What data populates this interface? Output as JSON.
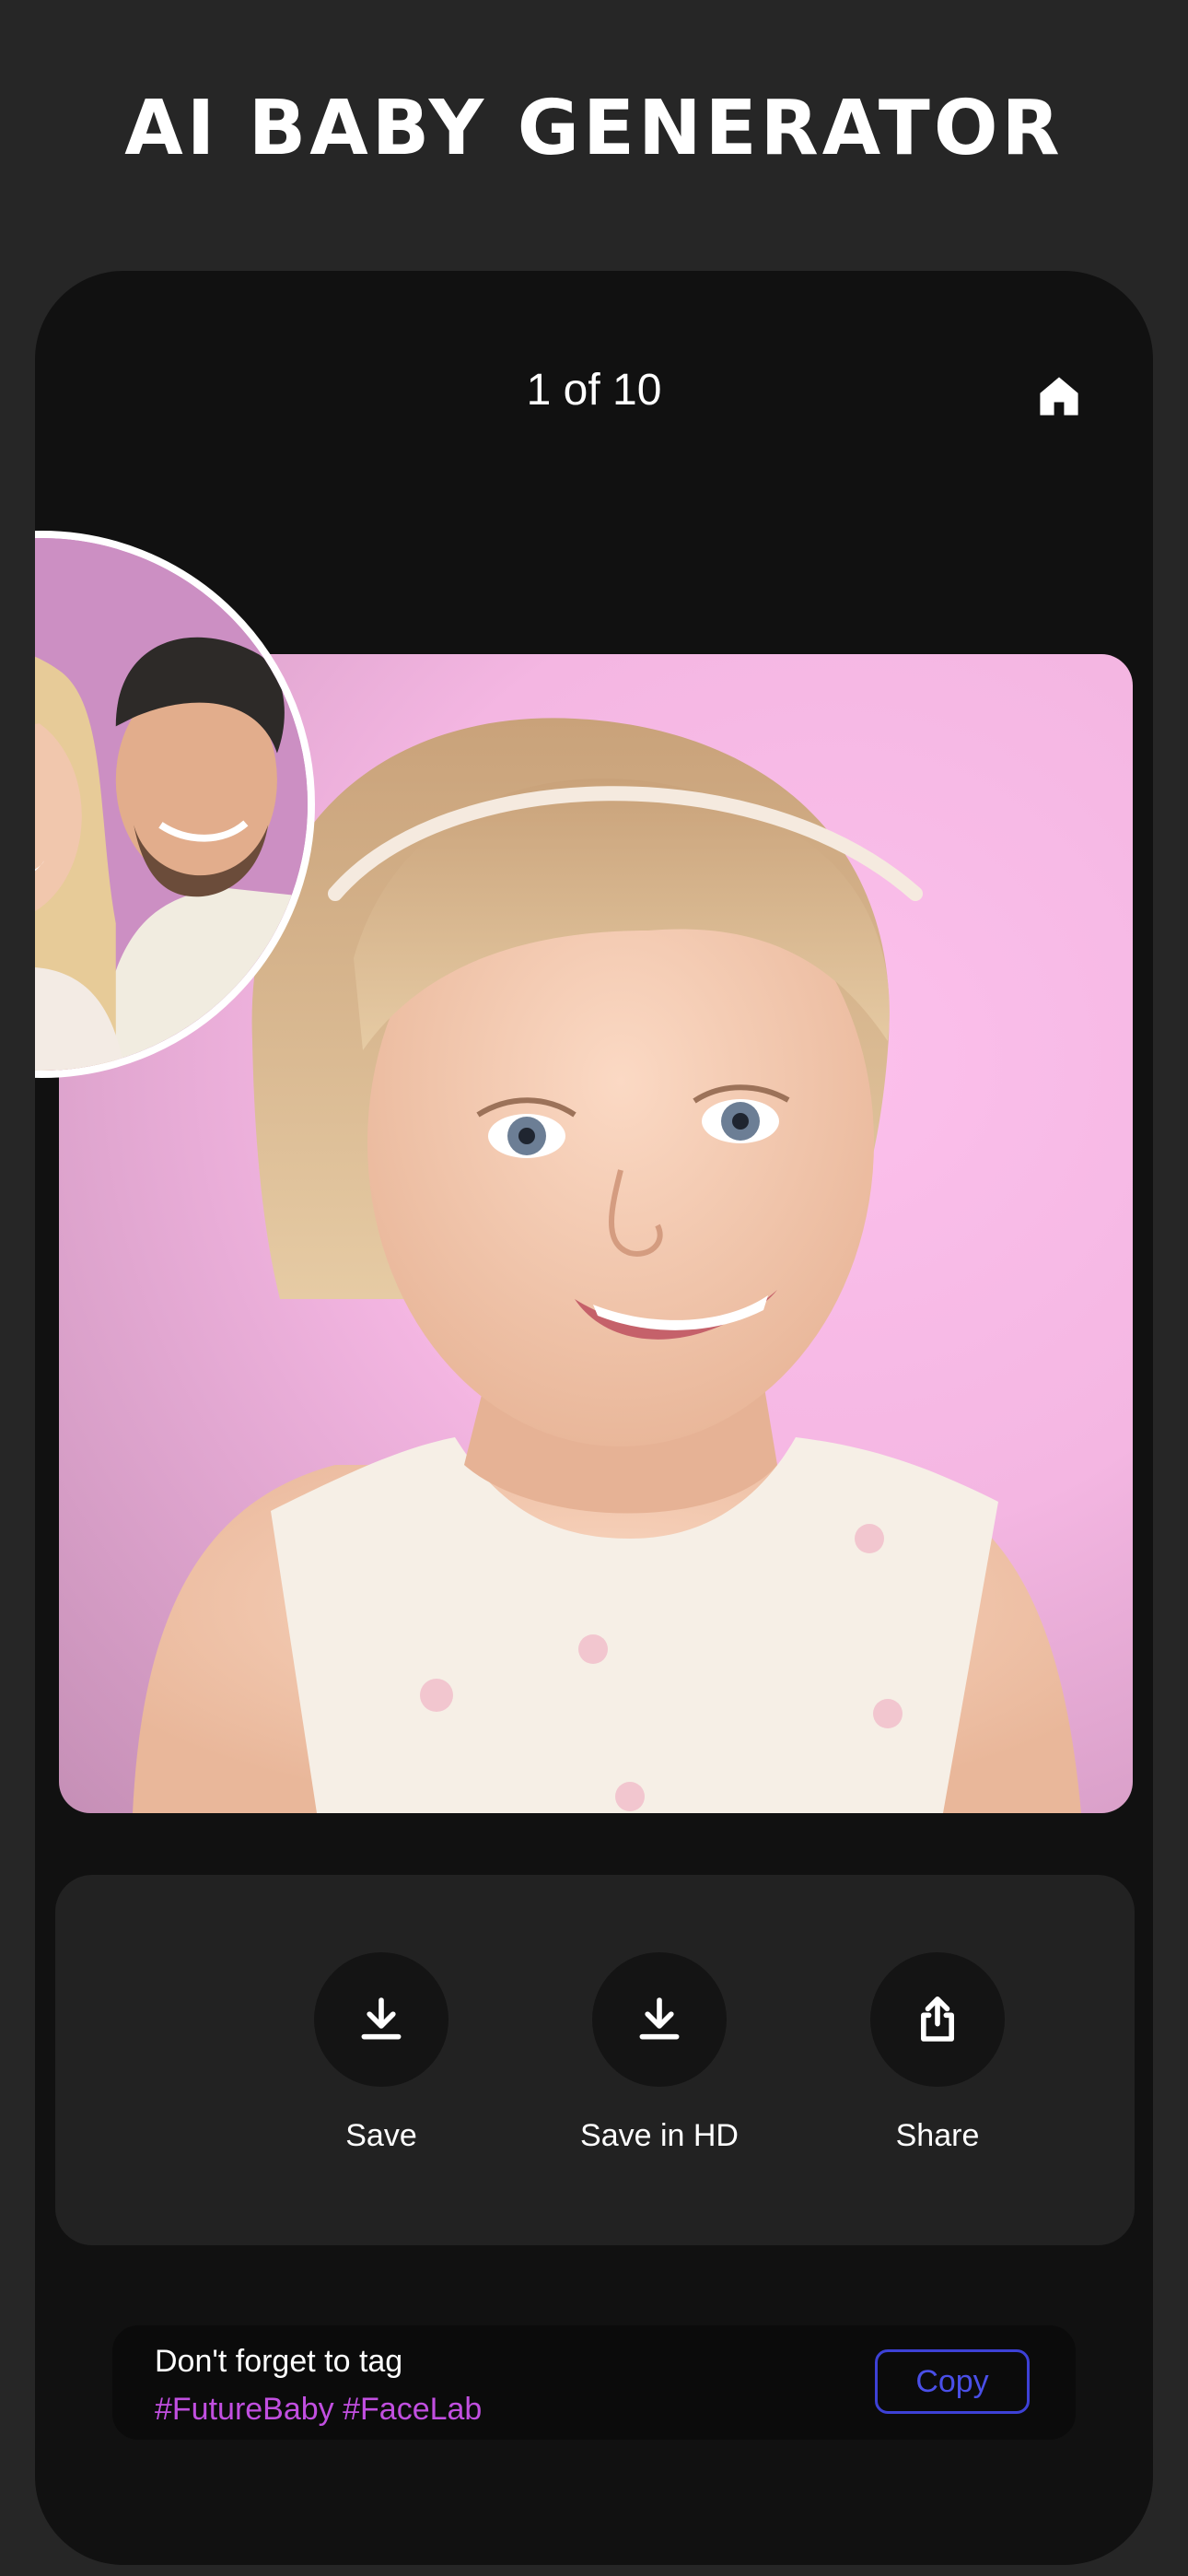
{
  "header": {
    "title": "AI BABY GENERATOR"
  },
  "viewer": {
    "counter": "1 of 10",
    "home_icon": "home-icon"
  },
  "actions": [
    {
      "label": "Save",
      "icon": "download-icon"
    },
    {
      "label": "Save in HD",
      "icon": "download-icon"
    },
    {
      "label": "Share",
      "icon": "share-icon"
    }
  ],
  "tag_bar": {
    "text": "Don't forget to tag",
    "hashtags": "#FutureBaby #FaceLab",
    "copy_label": "Copy"
  },
  "colors": {
    "background": "#262626",
    "frame": "#111111",
    "panel": "#222222",
    "hashtag": "#c14fe0",
    "copy_accent": "#3d41d6",
    "photo_background": "#f4b6e2"
  }
}
